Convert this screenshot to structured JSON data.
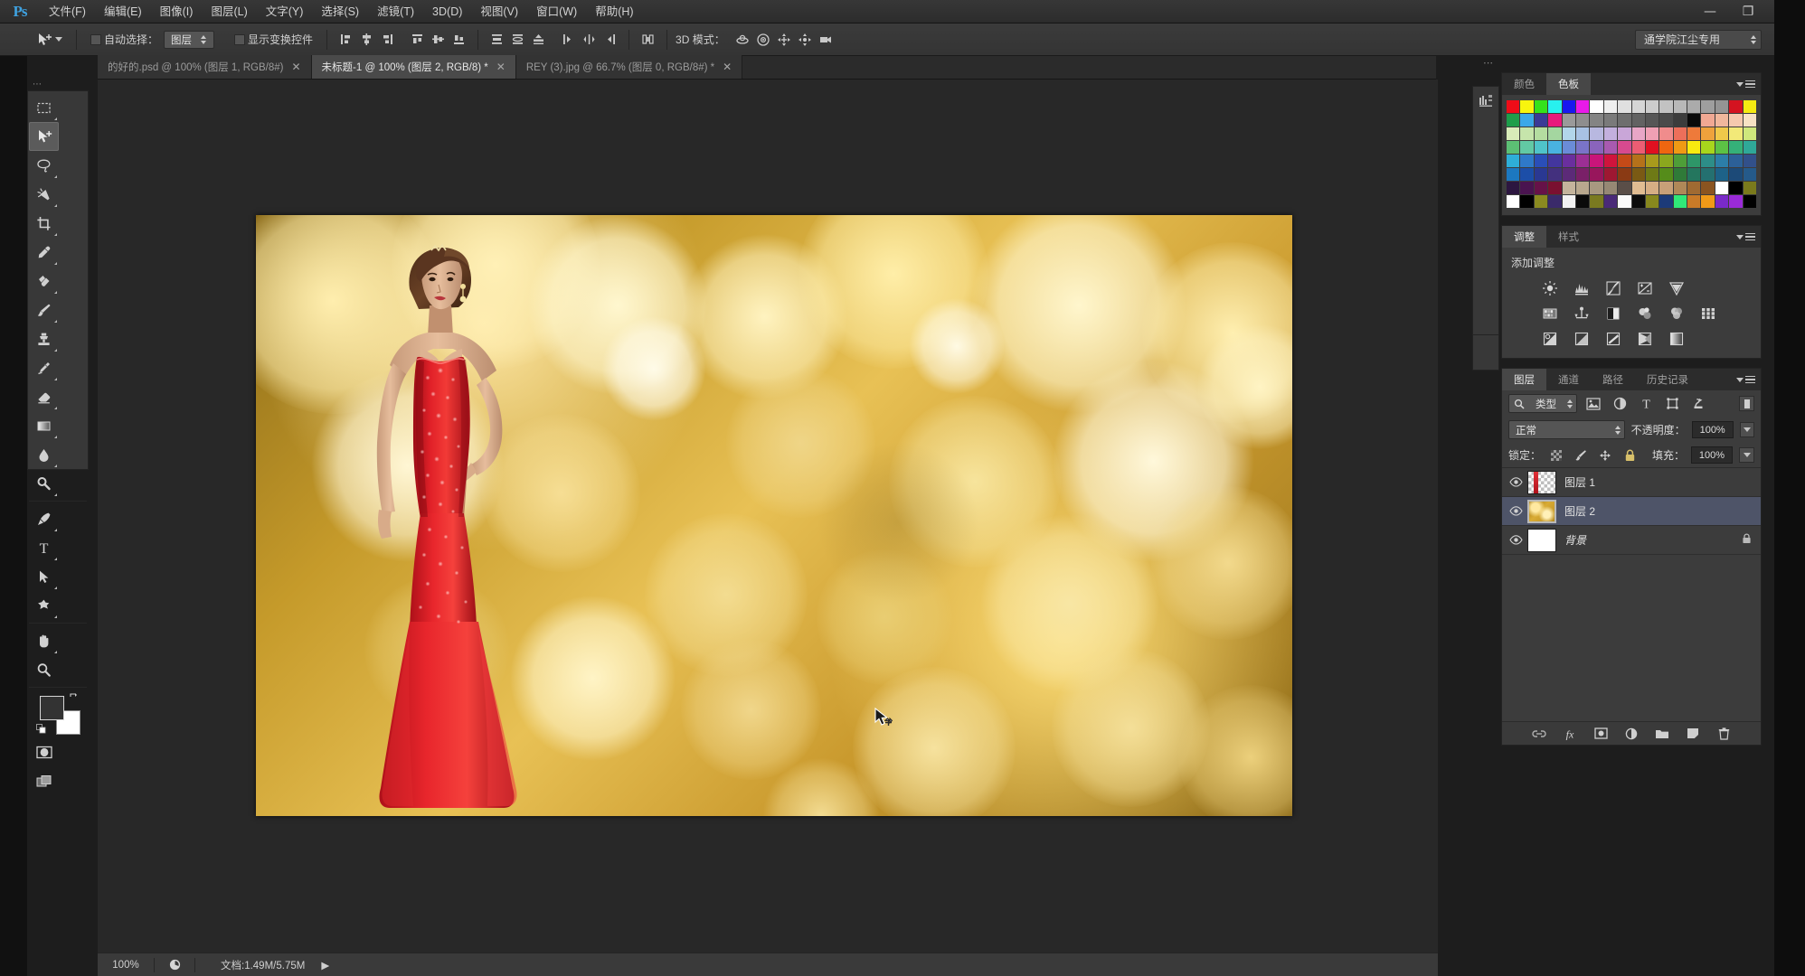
{
  "app": {
    "logo": "Ps",
    "menus": [
      {
        "label": "文件(F)"
      },
      {
        "label": "编辑(E)"
      },
      {
        "label": "图像(I)"
      },
      {
        "label": "图层(L)"
      },
      {
        "label": "文字(Y)"
      },
      {
        "label": "选择(S)"
      },
      {
        "label": "滤镜(T)"
      },
      {
        "label": "3D(D)"
      },
      {
        "label": "视图(V)"
      },
      {
        "label": "窗口(W)"
      },
      {
        "label": "帮助(H)"
      }
    ],
    "window_buttons": {
      "minimize": "—",
      "maximize": "❐",
      "close": "✕"
    }
  },
  "options_bar": {
    "auto_select_label": "自动选择：",
    "auto_select_value": "图层",
    "show_transform_label": "显示变换控件",
    "three_d_label": "3D 模式：",
    "workspace": "通学院江尘专用"
  },
  "tabs": [
    {
      "label": "的好的.psd @ 100% (图层 1, RGB/8#)",
      "active": false,
      "close": "✕"
    },
    {
      "label": "未标题-1 @ 100% (图层 2, RGB/8) *",
      "active": true,
      "close": "✕"
    },
    {
      "label": "REY (3).jpg @ 66.7% (图层 0, RGB/8#) *",
      "active": false,
      "close": "✕"
    }
  ],
  "toolbar": {
    "tools": [
      {
        "name": "rectangular-marquee-tool",
        "active": false
      },
      {
        "name": "move-tool",
        "active": true
      },
      {
        "name": "lasso-tool",
        "active": false
      },
      {
        "name": "magic-wand-tool",
        "active": false
      },
      {
        "name": "crop-tool",
        "active": false
      },
      {
        "name": "eyedropper-tool",
        "active": false
      },
      {
        "name": "spot-healing-brush-tool",
        "active": false
      },
      {
        "name": "brush-tool",
        "active": false
      },
      {
        "name": "clone-stamp-tool",
        "active": false
      },
      {
        "name": "history-brush-tool",
        "active": false
      },
      {
        "name": "eraser-tool",
        "active": false
      },
      {
        "name": "gradient-tool",
        "active": false
      },
      {
        "name": "blur-tool",
        "active": false
      },
      {
        "name": "dodge-tool",
        "active": false
      },
      {
        "name": "pen-tool",
        "active": false
      },
      {
        "name": "type-tool",
        "active": false
      },
      {
        "name": "path-selection-tool",
        "active": false
      },
      {
        "name": "custom-shape-tool",
        "active": false
      },
      {
        "name": "hand-tool",
        "active": false
      },
      {
        "name": "zoom-tool",
        "active": false
      }
    ],
    "foreground_color": "#333333",
    "background_color": "#ffffff"
  },
  "color_panel": {
    "tabs": [
      {
        "label": "颜色",
        "active": false
      },
      {
        "label": "色板",
        "active": true
      }
    ],
    "swatches": [
      "#ef0c18",
      "#f8f50e",
      "#34e21a",
      "#28f0ee",
      "#1818ef",
      "#e81ae8",
      "#ffffff",
      "#efefef",
      "#e0e0e0",
      "#d6d6d6",
      "#cccccc",
      "#c2c2c2",
      "#b8b8b8",
      "#ababab",
      "#9e9e9e",
      "#949494",
      "#d41320",
      "#f5ea12",
      "#1d9e4a",
      "#3ba8e8",
      "#3a3a96",
      "#e8187c",
      "#9a9a9a",
      "#8e8e8e",
      "#848484",
      "#7a7a7a",
      "#6e6e6e",
      "#626262",
      "#565656",
      "#4a4a4a",
      "#3c3c3c",
      "#0a0a0a",
      "#f0a893",
      "#f0b79c",
      "#f5c9ae",
      "#f7e2c4",
      "#d8ecb9",
      "#c6e5ab",
      "#b4dda0",
      "#a4d6a0",
      "#b2d6ea",
      "#a8c2e4",
      "#b8b8e0",
      "#c3b0de",
      "#c9a6d8",
      "#e8a6c6",
      "#f0a0b4",
      "#f08c8c",
      "#ed6f5a",
      "#ee7a3a",
      "#eea23c",
      "#f0c94a",
      "#f2e978",
      "#cfe87c",
      "#5cbf74",
      "#62c9a4",
      "#4fc3c9",
      "#49b2e0",
      "#6a8cd8",
      "#7a74c8",
      "#8a64bc",
      "#a85ab0",
      "#d74a8f",
      "#ec5d73",
      "#e01020",
      "#ee6610",
      "#f09a14",
      "#f8ea10",
      "#a8d61c",
      "#5cc245",
      "#35b079",
      "#2fa898",
      "#2eaed8",
      "#2f79c9",
      "#2a4eb8",
      "#43369e",
      "#6a2f9e",
      "#9c2f94",
      "#c9157a",
      "#d0143c",
      "#c44a18",
      "#b5721a",
      "#a89a1c",
      "#8ba81e",
      "#4e9e38",
      "#2e9668",
      "#2d8e88",
      "#2c7ea8",
      "#2c6098",
      "#32508a",
      "#1c78c0",
      "#1c4ea8",
      "#2a3892",
      "#43307e",
      "#5c2a78",
      "#7a2068",
      "#98165c",
      "#9e1832",
      "#8a3a14",
      "#7a5a14",
      "#6e7a16",
      "#558c1a",
      "#2f7a38",
      "#24765e",
      "#247070",
      "#1d6288",
      "#1c4a78",
      "#255a8a",
      "#2c1640",
      "#4a1450",
      "#661248",
      "#7a1030",
      "#c4b49c",
      "#b8a88e",
      "#a89880",
      "#968874",
      "#5a4e48",
      "#e0bc92",
      "#d6ae84",
      "#c8a078",
      "#b08858",
      "#a06a32",
      "#8a5420",
      "#ffffff",
      "#000000",
      "#7a7a1c",
      "#ffffff",
      "#000000",
      "#8a8a20",
      "#3a2a6a",
      "#f2f2f2",
      "#0a0a0a",
      "#7a7a20",
      "#4a2a78",
      "#fafafa",
      "#0c0c0c",
      "#88881e",
      "#1c3a78",
      "#30e878",
      "#c87a28",
      "#f09a18",
      "#7a2ac8",
      "#9a2ad8",
      "#000000"
    ]
  },
  "adjustments_panel": {
    "tabs": [
      {
        "label": "调整",
        "active": true
      },
      {
        "label": "样式",
        "active": false
      }
    ],
    "title": "添加调整",
    "icons": [
      [
        "brightness-contrast-icon",
        "levels-icon",
        "curves-icon",
        "exposure-icon",
        "vibrance-icon"
      ],
      [
        "hue-saturation-icon",
        "color-balance-icon",
        "black-white-icon",
        "photo-filter-icon",
        "channel-mixer-icon",
        "color-lookup-icon"
      ],
      [
        "invert-icon",
        "posterize-icon",
        "threshold-icon",
        "gradient-map-icon",
        "selective-color-icon"
      ]
    ]
  },
  "layers_panel": {
    "tabs": [
      {
        "label": "图层",
        "active": true
      },
      {
        "label": "通道",
        "active": false
      },
      {
        "label": "路径",
        "active": false
      },
      {
        "label": "历史记录",
        "active": false
      }
    ],
    "filter_label": "类型",
    "filter_icons": [
      "pixel-layer-filter-icon",
      "adjustment-layer-filter-icon",
      "type-layer-filter-icon",
      "shape-layer-filter-icon",
      "smart-object-filter-icon"
    ],
    "blend_mode": "正常",
    "opacity_label": "不透明度：",
    "opacity_value": "100%",
    "lock_label": "锁定：",
    "lock_icons": [
      "lock-transparency-icon",
      "lock-pixels-icon",
      "lock-position-icon",
      "lock-all-icon"
    ],
    "fill_label": "填充：",
    "fill_value": "100%",
    "layers": [
      {
        "name": "图层 1",
        "visible": true,
        "selected": false,
        "locked": false,
        "thumb": "transparent-red-strip"
      },
      {
        "name": "图层 2",
        "visible": true,
        "selected": true,
        "locked": false,
        "thumb": "gold-bokeh"
      },
      {
        "name": "背景",
        "visible": true,
        "selected": false,
        "locked": true,
        "thumb": "white",
        "italic": true
      }
    ],
    "footer_icons": [
      "link-layers-icon",
      "layer-style-fx-icon",
      "add-mask-icon",
      "new-adjustment-layer-icon",
      "new-group-icon",
      "new-layer-icon",
      "delete-layer-icon"
    ]
  },
  "status_bar": {
    "zoom": "100%",
    "doc_info": "文档:1.49M/5.75M",
    "arrow": "▶"
  },
  "canvas": {
    "document_title": "未标题-1",
    "subject_alt": "woman in red sequin gown on gold bokeh background"
  },
  "colors": {
    "accent_blue": "#3fa2e0",
    "panel_bg": "#3c3c3c",
    "panel_header": "#2c2c2c",
    "chrome_bg": "#383838",
    "canvas_bg": "#282828",
    "selected_layer": "#4e5468"
  }
}
